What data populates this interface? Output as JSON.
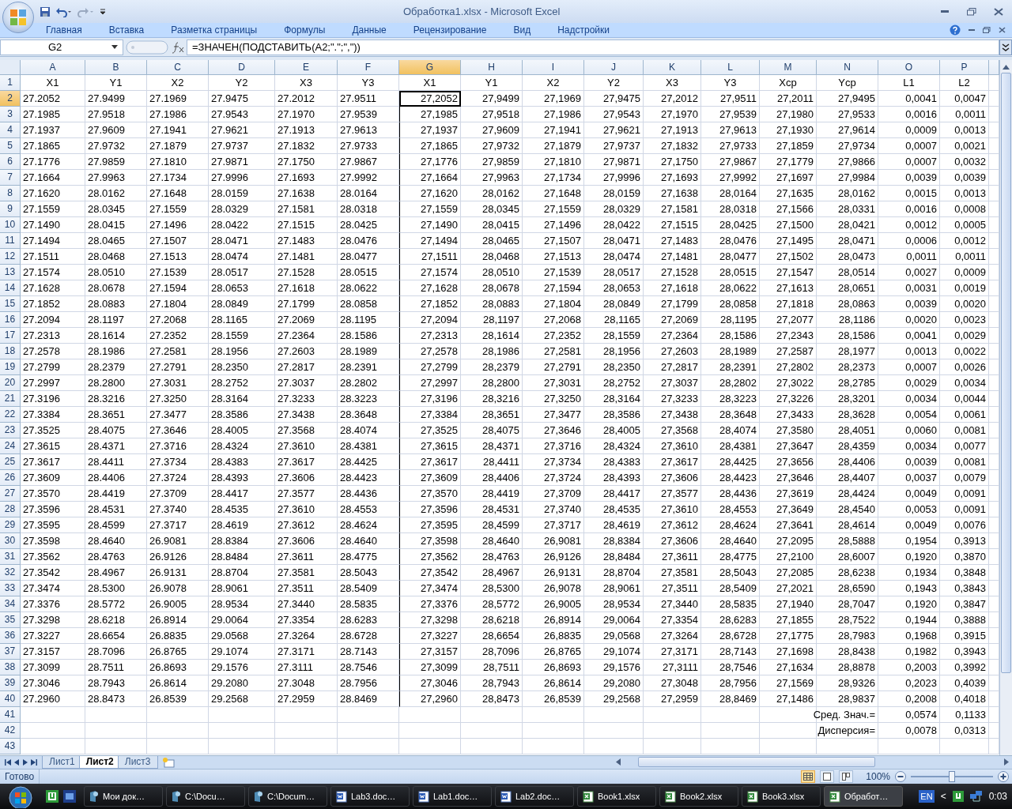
{
  "window": {
    "title": "Обработка1.xlsx - Microsoft Excel"
  },
  "ribbon_tabs": [
    {
      "label": "Главная"
    },
    {
      "label": "Вставка"
    },
    {
      "label": "Разметка страницы"
    },
    {
      "label": "Формулы"
    },
    {
      "label": "Данные"
    },
    {
      "label": "Рецензирование"
    },
    {
      "label": "Вид"
    },
    {
      "label": "Надстройки"
    }
  ],
  "formula_bar": {
    "name_box": "G2",
    "formula": "=ЗНАЧЕН(ПОДСТАВИТЬ(A2;\".\";\",\"))"
  },
  "columns": [
    {
      "letter": "A",
      "selected": false
    },
    {
      "letter": "B",
      "selected": false
    },
    {
      "letter": "C",
      "selected": false
    },
    {
      "letter": "D",
      "selected": false
    },
    {
      "letter": "E",
      "selected": false
    },
    {
      "letter": "F",
      "selected": false
    },
    {
      "letter": "G",
      "selected": true
    },
    {
      "letter": "H",
      "selected": false
    },
    {
      "letter": "I",
      "selected": false
    },
    {
      "letter": "J",
      "selected": false
    },
    {
      "letter": "K",
      "selected": false
    },
    {
      "letter": "L",
      "selected": false
    },
    {
      "letter": "M",
      "selected": false
    },
    {
      "letter": "N",
      "selected": false
    },
    {
      "letter": "O",
      "selected": false
    },
    {
      "letter": "P",
      "selected": false
    }
  ],
  "rows": [
    {
      "n": "1",
      "selected": false,
      "cells": [
        "X1",
        "Y1",
        "X2",
        "Y2",
        "X3",
        "Y3",
        "X1",
        "Y1",
        "X2",
        "Y2",
        "X3",
        "Y3",
        "Xcp",
        "Ycp",
        "L1",
        "L2"
      ]
    },
    {
      "n": "2",
      "selected": true,
      "cells": [
        "27.2052",
        "27.9499",
        "27.1969",
        "27.9475",
        "27.2012",
        "27.9511",
        "27,2052",
        "27,9499",
        "27,1969",
        "27,9475",
        "27,2012",
        "27,9511",
        "27,2011",
        "27,9495",
        "0,0041",
        "0,0047"
      ]
    },
    {
      "n": "3",
      "selected": false,
      "cells": [
        "27.1985",
        "27.9518",
        "27.1986",
        "27.9543",
        "27.1970",
        "27.9539",
        "27,1985",
        "27,9518",
        "27,1986",
        "27,9543",
        "27,1970",
        "27,9539",
        "27,1980",
        "27,9533",
        "0,0016",
        "0,0011"
      ]
    },
    {
      "n": "4",
      "selected": false,
      "cells": [
        "27.1937",
        "27.9609",
        "27.1941",
        "27.9621",
        "27.1913",
        "27.9613",
        "27,1937",
        "27,9609",
        "27,1941",
        "27,9621",
        "27,1913",
        "27,9613",
        "27,1930",
        "27,9614",
        "0,0009",
        "0,0013"
      ]
    },
    {
      "n": "5",
      "selected": false,
      "cells": [
        "27.1865",
        "27.9732",
        "27.1879",
        "27.9737",
        "27.1832",
        "27.9733",
        "27,1865",
        "27,9732",
        "27,1879",
        "27,9737",
        "27,1832",
        "27,9733",
        "27,1859",
        "27,9734",
        "0,0007",
        "0,0021"
      ]
    },
    {
      "n": "6",
      "selected": false,
      "cells": [
        "27.1776",
        "27.9859",
        "27.1810",
        "27.9871",
        "27.1750",
        "27.9867",
        "27,1776",
        "27,9859",
        "27,1810",
        "27,9871",
        "27,1750",
        "27,9867",
        "27,1779",
        "27,9866",
        "0,0007",
        "0,0032"
      ]
    },
    {
      "n": "7",
      "selected": false,
      "cells": [
        "27.1664",
        "27.9963",
        "27.1734",
        "27.9996",
        "27.1693",
        "27.9992",
        "27,1664",
        "27,9963",
        "27,1734",
        "27,9996",
        "27,1693",
        "27,9992",
        "27,1697",
        "27,9984",
        "0,0039",
        "0,0039"
      ]
    },
    {
      "n": "8",
      "selected": false,
      "cells": [
        "27.1620",
        "28.0162",
        "27.1648",
        "28.0159",
        "27.1638",
        "28.0164",
        "27,1620",
        "28,0162",
        "27,1648",
        "28,0159",
        "27,1638",
        "28,0164",
        "27,1635",
        "28,0162",
        "0,0015",
        "0,0013"
      ]
    },
    {
      "n": "9",
      "selected": false,
      "cells": [
        "27.1559",
        "28.0345",
        "27.1559",
        "28.0329",
        "27.1581",
        "28.0318",
        "27,1559",
        "28,0345",
        "27,1559",
        "28,0329",
        "27,1581",
        "28,0318",
        "27,1566",
        "28,0331",
        "0,0016",
        "0,0008"
      ]
    },
    {
      "n": "10",
      "selected": false,
      "cells": [
        "27.1490",
        "28.0415",
        "27.1496",
        "28.0422",
        "27.1515",
        "28.0425",
        "27,1490",
        "28,0415",
        "27,1496",
        "28,0422",
        "27,1515",
        "28,0425",
        "27,1500",
        "28,0421",
        "0,0012",
        "0,0005"
      ]
    },
    {
      "n": "11",
      "selected": false,
      "cells": [
        "27.1494",
        "28.0465",
        "27.1507",
        "28.0471",
        "27.1483",
        "28.0476",
        "27,1494",
        "28,0465",
        "27,1507",
        "28,0471",
        "27,1483",
        "28,0476",
        "27,1495",
        "28,0471",
        "0,0006",
        "0,0012"
      ]
    },
    {
      "n": "12",
      "selected": false,
      "cells": [
        "27.1511",
        "28.0468",
        "27.1513",
        "28.0474",
        "27.1481",
        "28.0477",
        "27,1511",
        "28,0468",
        "27,1513",
        "28,0474",
        "27,1481",
        "28,0477",
        "27,1502",
        "28,0473",
        "0,0011",
        "0,0011"
      ]
    },
    {
      "n": "13",
      "selected": false,
      "cells": [
        "27.1574",
        "28.0510",
        "27.1539",
        "28.0517",
        "27.1528",
        "28.0515",
        "27,1574",
        "28,0510",
        "27,1539",
        "28,0517",
        "27,1528",
        "28,0515",
        "27,1547",
        "28,0514",
        "0,0027",
        "0,0009"
      ]
    },
    {
      "n": "14",
      "selected": false,
      "cells": [
        "27.1628",
        "28.0678",
        "27.1594",
        "28.0653",
        "27.1618",
        "28.0622",
        "27,1628",
        "28,0678",
        "27,1594",
        "28,0653",
        "27,1618",
        "28,0622",
        "27,1613",
        "28,0651",
        "0,0031",
        "0,0019"
      ]
    },
    {
      "n": "15",
      "selected": false,
      "cells": [
        "27.1852",
        "28.0883",
        "27.1804",
        "28.0849",
        "27.1799",
        "28.0858",
        "27,1852",
        "28,0883",
        "27,1804",
        "28,0849",
        "27,1799",
        "28,0858",
        "27,1818",
        "28,0863",
        "0,0039",
        "0,0020"
      ]
    },
    {
      "n": "16",
      "selected": false,
      "cells": [
        "27.2094",
        "28.1197",
        "27.2068",
        "28.1165",
        "27.2069",
        "28.1195",
        "27,2094",
        "28,1197",
        "27,2068",
        "28,1165",
        "27,2069",
        "28,1195",
        "27,2077",
        "28,1186",
        "0,0020",
        "0,0023"
      ]
    },
    {
      "n": "17",
      "selected": false,
      "cells": [
        "27.2313",
        "28.1614",
        "27.2352",
        "28.1559",
        "27.2364",
        "28.1586",
        "27,2313",
        "28,1614",
        "27,2352",
        "28,1559",
        "27,2364",
        "28,1586",
        "27,2343",
        "28,1586",
        "0,0041",
        "0,0029"
      ]
    },
    {
      "n": "18",
      "selected": false,
      "cells": [
        "27.2578",
        "28.1986",
        "27.2581",
        "28.1956",
        "27.2603",
        "28.1989",
        "27,2578",
        "28,1986",
        "27,2581",
        "28,1956",
        "27,2603",
        "28,1989",
        "27,2587",
        "28,1977",
        "0,0013",
        "0,0022"
      ]
    },
    {
      "n": "19",
      "selected": false,
      "cells": [
        "27.2799",
        "28.2379",
        "27.2791",
        "28.2350",
        "27.2817",
        "28.2391",
        "27,2799",
        "28,2379",
        "27,2791",
        "28,2350",
        "27,2817",
        "28,2391",
        "27,2802",
        "28,2373",
        "0,0007",
        "0,0026"
      ]
    },
    {
      "n": "20",
      "selected": false,
      "cells": [
        "27.2997",
        "28.2800",
        "27.3031",
        "28.2752",
        "27.3037",
        "28.2802",
        "27,2997",
        "28,2800",
        "27,3031",
        "28,2752",
        "27,3037",
        "28,2802",
        "27,3022",
        "28,2785",
        "0,0029",
        "0,0034"
      ]
    },
    {
      "n": "21",
      "selected": false,
      "cells": [
        "27.3196",
        "28.3216",
        "27.3250",
        "28.3164",
        "27.3233",
        "28.3223",
        "27,3196",
        "28,3216",
        "27,3250",
        "28,3164",
        "27,3233",
        "28,3223",
        "27,3226",
        "28,3201",
        "0,0034",
        "0,0044"
      ]
    },
    {
      "n": "22",
      "selected": false,
      "cells": [
        "27.3384",
        "28.3651",
        "27.3477",
        "28.3586",
        "27.3438",
        "28.3648",
        "27,3384",
        "28,3651",
        "27,3477",
        "28,3586",
        "27,3438",
        "28,3648",
        "27,3433",
        "28,3628",
        "0,0054",
        "0,0061"
      ]
    },
    {
      "n": "23",
      "selected": false,
      "cells": [
        "27.3525",
        "28.4075",
        "27.3646",
        "28.4005",
        "27.3568",
        "28.4074",
        "27,3525",
        "28,4075",
        "27,3646",
        "28,4005",
        "27,3568",
        "28,4074",
        "27,3580",
        "28,4051",
        "0,0060",
        "0,0081"
      ]
    },
    {
      "n": "24",
      "selected": false,
      "cells": [
        "27.3615",
        "28.4371",
        "27.3716",
        "28.4324",
        "27.3610",
        "28.4381",
        "27,3615",
        "28,4371",
        "27,3716",
        "28,4324",
        "27,3610",
        "28,4381",
        "27,3647",
        "28,4359",
        "0,0034",
        "0,0077"
      ]
    },
    {
      "n": "25",
      "selected": false,
      "cells": [
        "27.3617",
        "28.4411",
        "27.3734",
        "28.4383",
        "27.3617",
        "28.4425",
        "27,3617",
        "28,4411",
        "27,3734",
        "28,4383",
        "27,3617",
        "28,4425",
        "27,3656",
        "28,4406",
        "0,0039",
        "0,0081"
      ]
    },
    {
      "n": "26",
      "selected": false,
      "cells": [
        "27.3609",
        "28.4406",
        "27.3724",
        "28.4393",
        "27.3606",
        "28.4423",
        "27,3609",
        "28,4406",
        "27,3724",
        "28,4393",
        "27,3606",
        "28,4423",
        "27,3646",
        "28,4407",
        "0,0037",
        "0,0079"
      ]
    },
    {
      "n": "27",
      "selected": false,
      "cells": [
        "27.3570",
        "28.4419",
        "27.3709",
        "28.4417",
        "27.3577",
        "28.4436",
        "27,3570",
        "28,4419",
        "27,3709",
        "28,4417",
        "27,3577",
        "28,4436",
        "27,3619",
        "28,4424",
        "0,0049",
        "0,0091"
      ]
    },
    {
      "n": "28",
      "selected": false,
      "cells": [
        "27.3596",
        "28.4531",
        "27.3740",
        "28.4535",
        "27.3610",
        "28.4553",
        "27,3596",
        "28,4531",
        "27,3740",
        "28,4535",
        "27,3610",
        "28,4553",
        "27,3649",
        "28,4540",
        "0,0053",
        "0,0091"
      ]
    },
    {
      "n": "29",
      "selected": false,
      "cells": [
        "27.3595",
        "28.4599",
        "27.3717",
        "28.4619",
        "27.3612",
        "28.4624",
        "27,3595",
        "28,4599",
        "27,3717",
        "28,4619",
        "27,3612",
        "28,4624",
        "27,3641",
        "28,4614",
        "0,0049",
        "0,0076"
      ]
    },
    {
      "n": "30",
      "selected": false,
      "cells": [
        "27.3598",
        "28.4640",
        "26.9081",
        "28.8384",
        "27.3606",
        "28.4640",
        "27,3598",
        "28,4640",
        "26,9081",
        "28,8384",
        "27,3606",
        "28,4640",
        "27,2095",
        "28,5888",
        "0,1954",
        "0,3913"
      ]
    },
    {
      "n": "31",
      "selected": false,
      "cells": [
        "27.3562",
        "28.4763",
        "26.9126",
        "28.8484",
        "27.3611",
        "28.4775",
        "27,3562",
        "28,4763",
        "26,9126",
        "28,8484",
        "27,3611",
        "28,4775",
        "27,2100",
        "28,6007",
        "0,1920",
        "0,3870"
      ]
    },
    {
      "n": "32",
      "selected": false,
      "cells": [
        "27.3542",
        "28.4967",
        "26.9131",
        "28.8704",
        "27.3581",
        "28.5043",
        "27,3542",
        "28,4967",
        "26,9131",
        "28,8704",
        "27,3581",
        "28,5043",
        "27,2085",
        "28,6238",
        "0,1934",
        "0,3848"
      ]
    },
    {
      "n": "33",
      "selected": false,
      "cells": [
        "27.3474",
        "28.5300",
        "26.9078",
        "28.9061",
        "27.3511",
        "28.5409",
        "27,3474",
        "28,5300",
        "26,9078",
        "28,9061",
        "27,3511",
        "28,5409",
        "27,2021",
        "28,6590",
        "0,1943",
        "0,3843"
      ]
    },
    {
      "n": "34",
      "selected": false,
      "cells": [
        "27.3376",
        "28.5772",
        "26.9005",
        "28.9534",
        "27.3440",
        "28.5835",
        "27,3376",
        "28,5772",
        "26,9005",
        "28,9534",
        "27,3440",
        "28,5835",
        "27,1940",
        "28,7047",
        "0,1920",
        "0,3847"
      ]
    },
    {
      "n": "35",
      "selected": false,
      "cells": [
        "27.3298",
        "28.6218",
        "26.8914",
        "29.0064",
        "27.3354",
        "28.6283",
        "27,3298",
        "28,6218",
        "26,8914",
        "29,0064",
        "27,3354",
        "28,6283",
        "27,1855",
        "28,7522",
        "0,1944",
        "0,3888"
      ]
    },
    {
      "n": "36",
      "selected": false,
      "cells": [
        "27.3227",
        "28.6654",
        "26.8835",
        "29.0568",
        "27.3264",
        "28.6728",
        "27,3227",
        "28,6654",
        "26,8835",
        "29,0568",
        "27,3264",
        "28,6728",
        "27,1775",
        "28,7983",
        "0,1968",
        "0,3915"
      ]
    },
    {
      "n": "37",
      "selected": false,
      "cells": [
        "27.3157",
        "28.7096",
        "26.8765",
        "29.1074",
        "27.3171",
        "28.7143",
        "27,3157",
        "28,7096",
        "26,8765",
        "29,1074",
        "27,3171",
        "28,7143",
        "27,1698",
        "28,8438",
        "0,1982",
        "0,3943"
      ]
    },
    {
      "n": "38",
      "selected": false,
      "cells": [
        "27.3099",
        "28.7511",
        "26.8693",
        "29.1576",
        "27.3111",
        "28.7546",
        "27,3099",
        "28,7511",
        "26,8693",
        "29,1576",
        "27,3111",
        "28,7546",
        "27,1634",
        "28,8878",
        "0,2003",
        "0,3992"
      ]
    },
    {
      "n": "39",
      "selected": false,
      "cells": [
        "27.3046",
        "28.7943",
        "26.8614",
        "29.2080",
        "27.3048",
        "28.7956",
        "27,3046",
        "28,7943",
        "26,8614",
        "29,2080",
        "27,3048",
        "28,7956",
        "27,1569",
        "28,9326",
        "0,2023",
        "0,4039"
      ]
    },
    {
      "n": "40",
      "selected": false,
      "cells": [
        "27.2960",
        "28.8473",
        "26.8539",
        "29.2568",
        "27.2959",
        "28.8469",
        "27,2960",
        "28,8473",
        "26,8539",
        "29,2568",
        "27,2959",
        "28,8469",
        "27,1486",
        "28,9837",
        "0,2008",
        "0,4018"
      ]
    }
  ],
  "summary_rows": [
    {
      "n": "41",
      "selected": false,
      "label": "Сред. Знач.=",
      "values": [
        "0,0574",
        "0,1133"
      ]
    },
    {
      "n": "42",
      "selected": false,
      "label": "Дисперсия=",
      "values": [
        "0,0078",
        "0,0313"
      ]
    }
  ],
  "empty_rows": [
    {
      "n": "43",
      "selected": false
    }
  ],
  "sheet_tabs": [
    {
      "label": "Лист1",
      "selected": false
    },
    {
      "label": "Лист2",
      "selected": true
    },
    {
      "label": "Лист3",
      "selected": false
    }
  ],
  "status_bar": {
    "text": "Готово",
    "zoom": "100%",
    "zoom_level": {
      "level": 0.5
    }
  },
  "taskbar": {
    "buttons": [
      {
        "label": "Мои док…",
        "kind": "folder",
        "selected": false
      },
      {
        "label": "C:\\Docu…",
        "kind": "folder",
        "selected": false
      },
      {
        "label": "C:\\Docum…",
        "kind": "folder",
        "selected": false
      },
      {
        "label": "Lab3.doc…",
        "kind": "word",
        "selected": false
      },
      {
        "label": "Lab1.doc…",
        "kind": "word",
        "selected": false
      },
      {
        "label": "Lab2.doc…",
        "kind": "word",
        "selected": false
      },
      {
        "label": "Book1.xlsx",
        "kind": "excel",
        "selected": false
      },
      {
        "label": "Book2.xlsx",
        "kind": "excel",
        "selected": false
      },
      {
        "label": "Book3.xlsx",
        "kind": "excel",
        "selected": false
      },
      {
        "label": "Обработ…",
        "kind": "excel",
        "selected": true
      }
    ],
    "language": "EN",
    "chevron": "<",
    "clock": "0:03"
  }
}
